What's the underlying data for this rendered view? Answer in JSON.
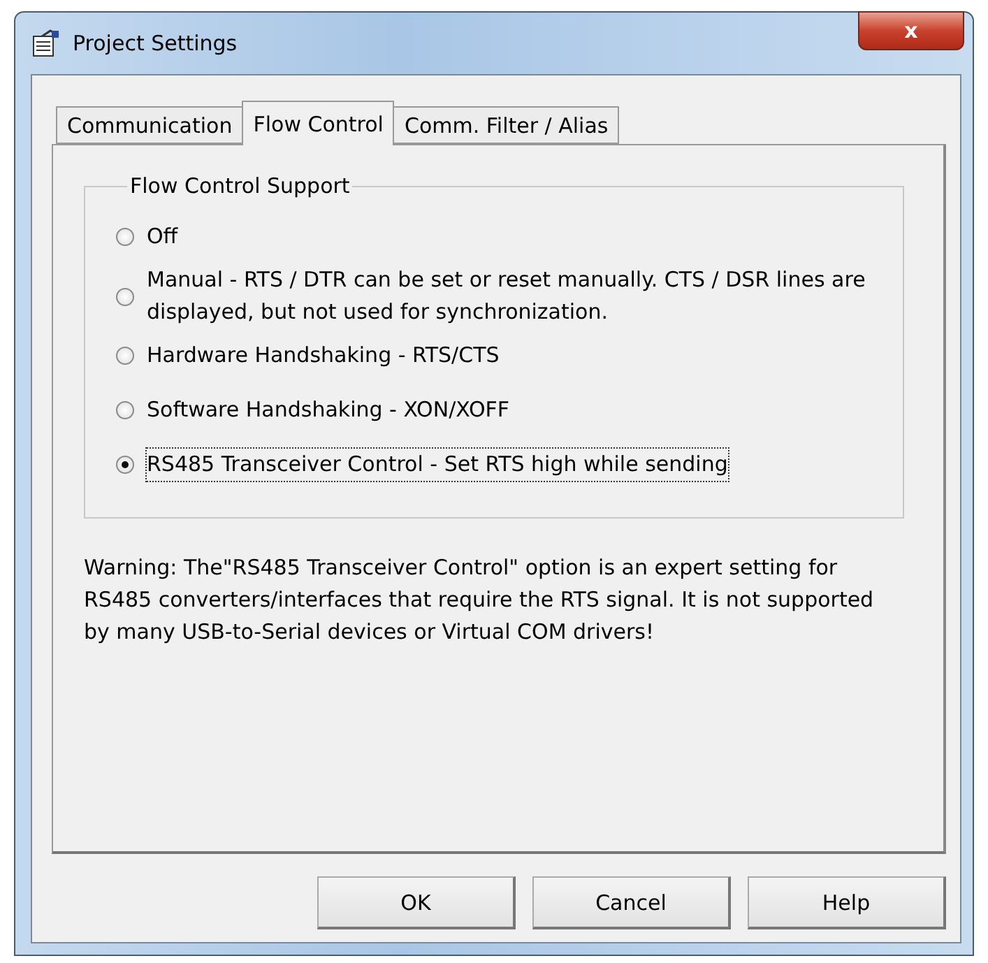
{
  "window": {
    "title": "Project Settings",
    "close": "x"
  },
  "tabs": [
    {
      "label": "Communication",
      "selected": false
    },
    {
      "label": "Flow Control",
      "selected": true
    },
    {
      "label": "Comm. Filter / Alias",
      "selected": false
    }
  ],
  "group": {
    "title": "Flow Control Support",
    "options": [
      {
        "label": "Off",
        "selected": false
      },
      {
        "label": "Manual  -  RTS / DTR can be set or reset manually. CTS / DSR lines are displayed, but not used for synchronization.",
        "selected": false
      },
      {
        "label": "Hardware Handshaking - RTS/CTS",
        "selected": false
      },
      {
        "label": "Software Handshaking -  XON/XOFF",
        "selected": false
      },
      {
        "label": "RS485 Transceiver Control - Set RTS high while sending",
        "selected": true
      }
    ]
  },
  "warning": "Warning: The\"RS485 Transceiver Control\" option is an expert setting for RS485 converters/interfaces that require the RTS signal. It is not supported by many USB-to-Serial devices or Virtual COM drivers!",
  "buttons": [
    "OK",
    "Cancel",
    "Help"
  ]
}
